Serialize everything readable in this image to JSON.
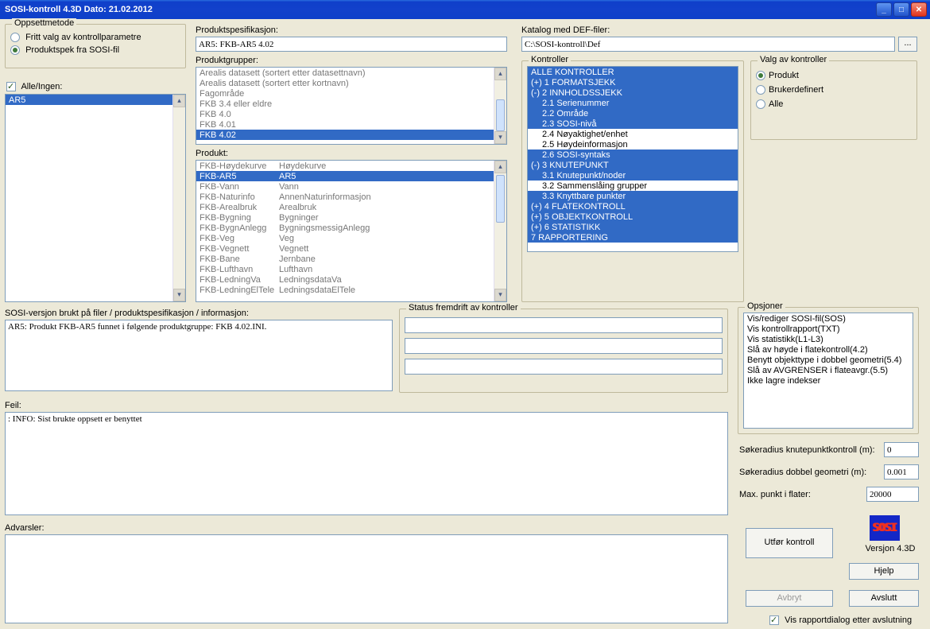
{
  "titlebar": "SOSI-kontroll 4.3D   Dato: 21.02.2012",
  "oppsett": {
    "cap": "Oppsettmetode",
    "opt1": "Fritt valg av kontrollparametre",
    "opt2": "Produktspek fra SOSI-fil"
  },
  "alleIngen": "Alle/Ingen:",
  "ar5_item": "AR5",
  "produktspes": {
    "label": "Produktspesifikasjon:",
    "value": "AR5: FKB-AR5 4.02"
  },
  "produktgrupper": {
    "label": "Produktgrupper:",
    "items": [
      {
        "t": "Arealis datasett (sortert etter datasettnavn)",
        "c": "dim"
      },
      {
        "t": "Arealis datasett (sortert etter kortnavn)",
        "c": "dim"
      },
      {
        "t": "Fagområde",
        "c": "dim"
      },
      {
        "t": "FKB 3.4 eller eldre",
        "c": "dim"
      },
      {
        "t": "FKB 4.0",
        "c": "dim"
      },
      {
        "t": "FKB 4.01",
        "c": "dim"
      },
      {
        "t": "FKB 4.02",
        "c": "sel"
      }
    ]
  },
  "produkt": {
    "label": "Produkt:",
    "rows": [
      {
        "a": "FKB-Høydekurve",
        "b": "Høydekurve",
        "c": "dim"
      },
      {
        "a": "FKB-AR5",
        "b": "AR5",
        "c": "sel"
      },
      {
        "a": "FKB-Vann",
        "b": "Vann",
        "c": "dim"
      },
      {
        "a": "FKB-Naturinfo",
        "b": "AnnenNaturinformasjon",
        "c": "dim"
      },
      {
        "a": "FKB-Arealbruk",
        "b": "Arealbruk",
        "c": "dim"
      },
      {
        "a": "FKB-Bygning",
        "b": "Bygninger",
        "c": "dim"
      },
      {
        "a": "FKB-BygnAnlegg",
        "b": "BygningsmessigAnlegg",
        "c": "dim"
      },
      {
        "a": "FKB-Veg",
        "b": "Veg",
        "c": "dim"
      },
      {
        "a": "FKB-Vegnett",
        "b": "Vegnett",
        "c": "dim"
      },
      {
        "a": "FKB-Bane",
        "b": "Jernbane",
        "c": "dim"
      },
      {
        "a": "FKB-Lufthavn",
        "b": "Lufthavn",
        "c": "dim"
      },
      {
        "a": "FKB-LedningVa",
        "b": "LedningsdataVa",
        "c": "dim"
      },
      {
        "a": "FKB-LedningElTele",
        "b": "LedningsdataElTele",
        "c": "dim"
      }
    ]
  },
  "katalog": {
    "label": "Katalog med DEF-filer:",
    "value": "C:\\SOSI-kontroll\\Def"
  },
  "kontroller": {
    "cap": "Kontroller",
    "items": [
      {
        "t": "ALLE KONTROLLER",
        "c": "sel"
      },
      {
        "t": "(+) 1 FORMATSJEKK",
        "c": "sel"
      },
      {
        "t": "(-) 2 INNHOLDSSJEKK",
        "c": "sel"
      },
      {
        "t": "2.1 Serienummer",
        "c": "sel ind1"
      },
      {
        "t": "2.2 Område",
        "c": "sel ind1"
      },
      {
        "t": "2.3 SOSI-nivå",
        "c": "sel ind1"
      },
      {
        "t": "2.4 Nøyaktighet/enhet",
        "c": "ind1"
      },
      {
        "t": "2.5 Høydeinformasjon",
        "c": "ind1"
      },
      {
        "t": "2.6 SOSI-syntaks",
        "c": "sel ind1"
      },
      {
        "t": "(-) 3 KNUTEPUNKT",
        "c": "sel"
      },
      {
        "t": "3.1 Knutepunkt/noder",
        "c": "sel ind1"
      },
      {
        "t": "3.2 Sammenslåing grupper",
        "c": "ind1"
      },
      {
        "t": "3.3 Knyttbare punkter",
        "c": "sel ind1"
      },
      {
        "t": "(+) 4 FLATEKONTROLL",
        "c": "sel"
      },
      {
        "t": "(+) 5 OBJEKTKONTROLL",
        "c": "sel"
      },
      {
        "t": "(+) 6 STATISTIKK",
        "c": "sel"
      },
      {
        "t": "7 RAPPORTERING",
        "c": "sel"
      }
    ]
  },
  "valg": {
    "cap": "Valg av kontroller",
    "o1": "Produkt",
    "o2": "Brukerdefinert",
    "o3": "Alle"
  },
  "sosiver": {
    "label": "SOSI-versjon brukt på filer / produktspesifikasjon / informasjon:",
    "text": "AR5: Produkt FKB-AR5 funnet i følgende produktgruppe: FKB 4.02.INI."
  },
  "status_cap": "Status fremdrift av kontroller",
  "feil": {
    "label": "Feil:",
    "text": ": INFO: Sist brukte oppsett er benyttet"
  },
  "adv_label": "Advarsler:",
  "opsjoner": {
    "cap": "Opsjoner",
    "items": [
      "Vis/rediger SOSI-fil(SOS)",
      "Vis kontrollrapport(TXT)",
      "Vis statistikk(L1-L3)",
      "Slå av høyde i flatekontroll(4.2)",
      "Benytt objekttype i dobbel geometri(5.4)",
      "Slå av AVGRENSER i flateavgr.(5.5)",
      "Ikke lagre indekser"
    ]
  },
  "p1": {
    "l": "Søkeradius knutepunktkontroll (m):",
    "v": "0"
  },
  "p2": {
    "l": "Søkeradius dobbel geometri (m):",
    "v": "0.001"
  },
  "p3": {
    "l": "Max. punkt i flater:",
    "v": "20000"
  },
  "btns": {
    "utfor": "Utfør kontroll",
    "ver": "Versjon 4.3D",
    "hjelp": "Hjelp",
    "avbryt": "Avbryt",
    "avslutt": "Avslutt"
  },
  "visrapport": "Vis rapportdialog etter avslutning",
  "logotext": "SOSI"
}
